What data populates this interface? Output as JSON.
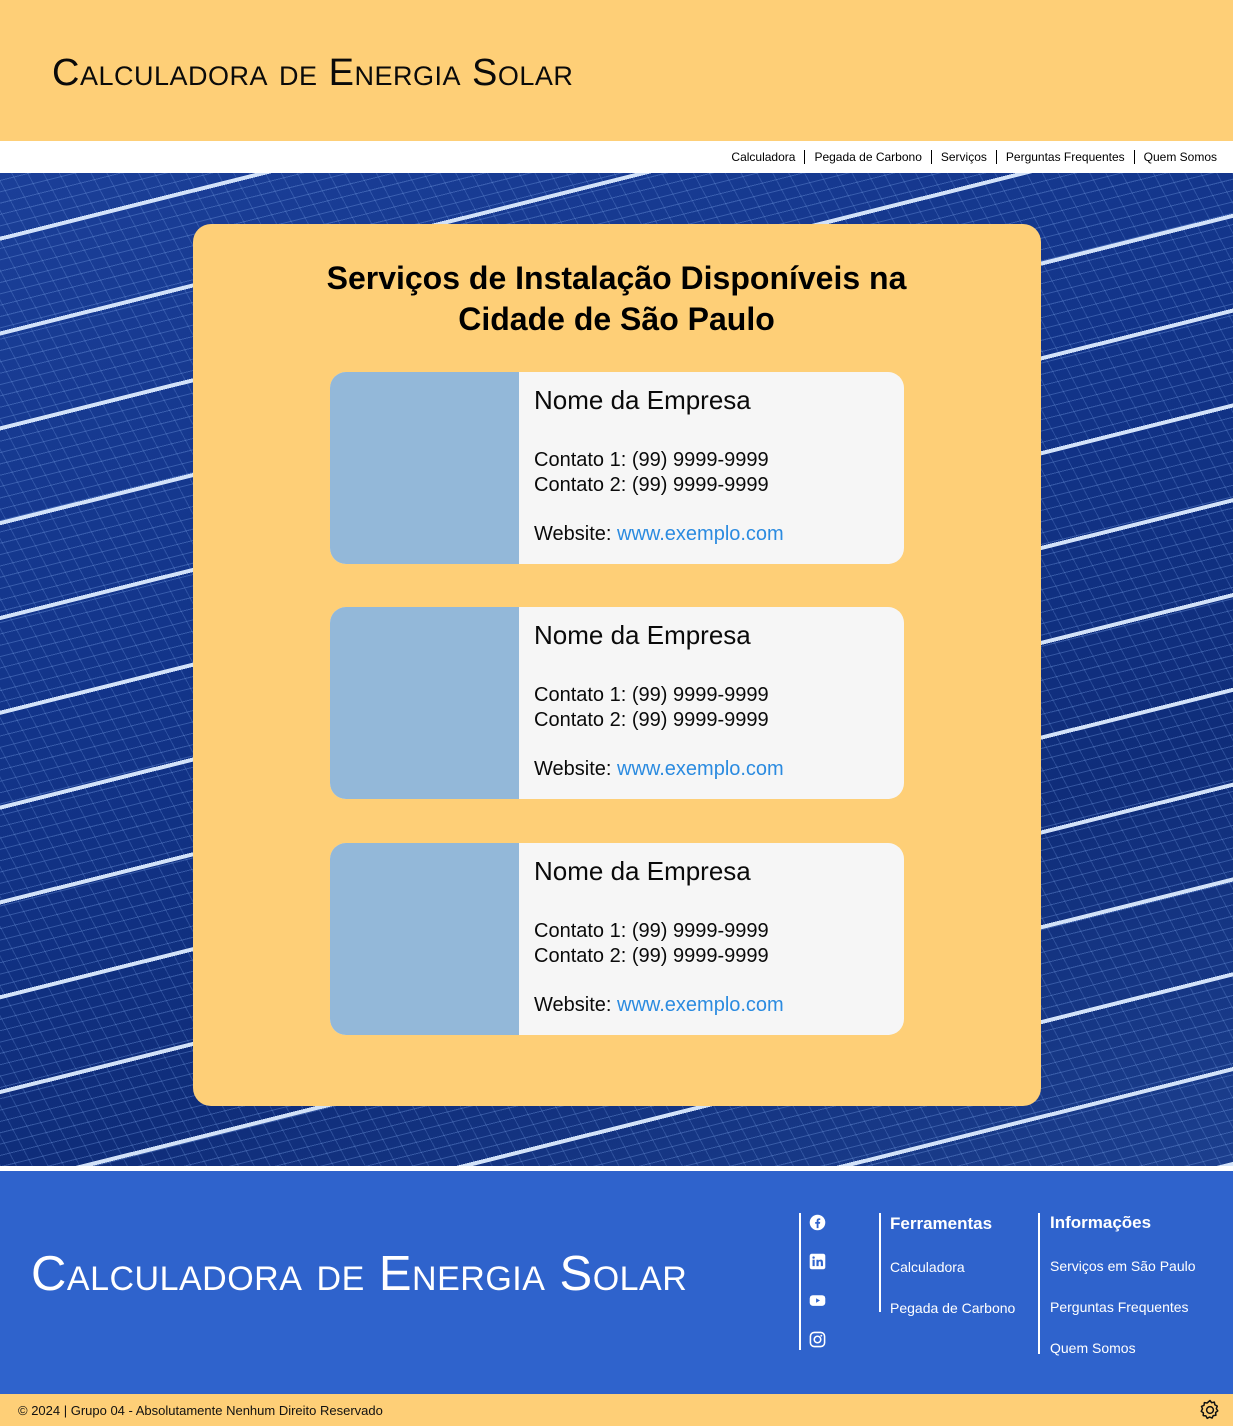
{
  "header": {
    "title": "Calculadora de Energia Solar"
  },
  "nav": {
    "items": [
      {
        "label": "Calculadora"
      },
      {
        "label": "Pegada de Carbono"
      },
      {
        "label": "Serviços"
      },
      {
        "label": "Perguntas Frequentes"
      },
      {
        "label": "Quem Somos"
      }
    ]
  },
  "main": {
    "title_line1": "Serviços de Instalação Disponíveis na",
    "title_line2": "Cidade de São Paulo",
    "companies": [
      {
        "name": "Nome da Empresa",
        "contact1": "Contato 1: (99) 9999-9999",
        "contact2": "Contato 2: (99) 9999-9999",
        "website_label": "Website: ",
        "website": "www.exemplo.com"
      },
      {
        "name": "Nome da Empresa",
        "contact1": "Contato 1: (99) 9999-9999",
        "contact2": "Contato 2: (99) 9999-9999",
        "website_label": "Website: ",
        "website": "www.exemplo.com"
      },
      {
        "name": "Nome da Empresa",
        "contact1": "Contato 1: (99) 9999-9999",
        "contact2": "Contato 2: (99) 9999-9999",
        "website_label": "Website: ",
        "website": "www.exemplo.com"
      }
    ]
  },
  "footer": {
    "title": "Calculadora de Energia Solar",
    "social": [
      "facebook-icon",
      "linkedin-icon",
      "youtube-icon",
      "instagram-icon"
    ],
    "tools": {
      "title": "Ferramentas",
      "links": [
        "Calculadora",
        "Pegada de Carbono"
      ]
    },
    "info": {
      "title": "Informações",
      "links": [
        "Serviços em São Paulo",
        "Perguntas Frequentes",
        "Quem Somos"
      ]
    }
  },
  "bottom_bar": {
    "copyright": "© 2024 | Grupo 04 - Absolutamente Nenhum Direito Reservado"
  },
  "colors": {
    "accent_yellow": "#fecf77",
    "footer_blue": "#2f63cc",
    "link_blue": "#2b8be0",
    "placeholder_image": "#93b8d9"
  }
}
